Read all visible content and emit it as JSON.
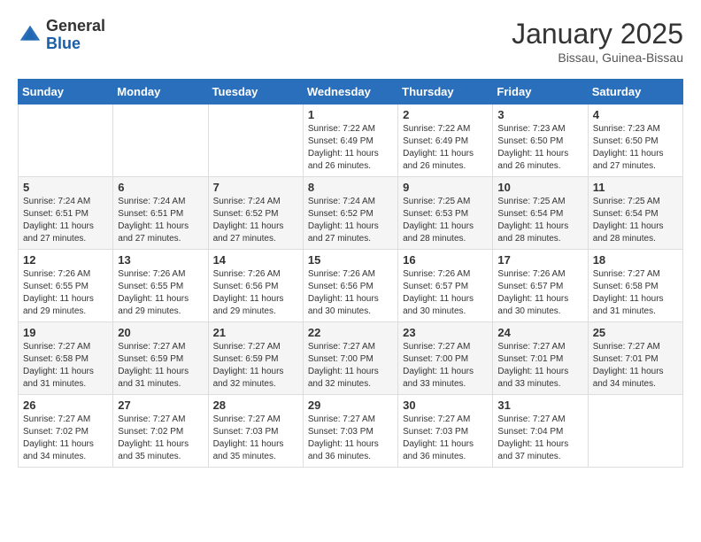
{
  "header": {
    "logo_general": "General",
    "logo_blue": "Blue",
    "title": "January 2025",
    "location": "Bissau, Guinea-Bissau"
  },
  "days_of_week": [
    "Sunday",
    "Monday",
    "Tuesday",
    "Wednesday",
    "Thursday",
    "Friday",
    "Saturday"
  ],
  "weeks": [
    [
      {
        "day": "",
        "info": ""
      },
      {
        "day": "",
        "info": ""
      },
      {
        "day": "",
        "info": ""
      },
      {
        "day": "1",
        "info": "Sunrise: 7:22 AM\nSunset: 6:49 PM\nDaylight: 11 hours and 26 minutes."
      },
      {
        "day": "2",
        "info": "Sunrise: 7:22 AM\nSunset: 6:49 PM\nDaylight: 11 hours and 26 minutes."
      },
      {
        "day": "3",
        "info": "Sunrise: 7:23 AM\nSunset: 6:50 PM\nDaylight: 11 hours and 26 minutes."
      },
      {
        "day": "4",
        "info": "Sunrise: 7:23 AM\nSunset: 6:50 PM\nDaylight: 11 hours and 27 minutes."
      }
    ],
    [
      {
        "day": "5",
        "info": "Sunrise: 7:24 AM\nSunset: 6:51 PM\nDaylight: 11 hours and 27 minutes."
      },
      {
        "day": "6",
        "info": "Sunrise: 7:24 AM\nSunset: 6:51 PM\nDaylight: 11 hours and 27 minutes."
      },
      {
        "day": "7",
        "info": "Sunrise: 7:24 AM\nSunset: 6:52 PM\nDaylight: 11 hours and 27 minutes."
      },
      {
        "day": "8",
        "info": "Sunrise: 7:24 AM\nSunset: 6:52 PM\nDaylight: 11 hours and 27 minutes."
      },
      {
        "day": "9",
        "info": "Sunrise: 7:25 AM\nSunset: 6:53 PM\nDaylight: 11 hours and 28 minutes."
      },
      {
        "day": "10",
        "info": "Sunrise: 7:25 AM\nSunset: 6:54 PM\nDaylight: 11 hours and 28 minutes."
      },
      {
        "day": "11",
        "info": "Sunrise: 7:25 AM\nSunset: 6:54 PM\nDaylight: 11 hours and 28 minutes."
      }
    ],
    [
      {
        "day": "12",
        "info": "Sunrise: 7:26 AM\nSunset: 6:55 PM\nDaylight: 11 hours and 29 minutes."
      },
      {
        "day": "13",
        "info": "Sunrise: 7:26 AM\nSunset: 6:55 PM\nDaylight: 11 hours and 29 minutes."
      },
      {
        "day": "14",
        "info": "Sunrise: 7:26 AM\nSunset: 6:56 PM\nDaylight: 11 hours and 29 minutes."
      },
      {
        "day": "15",
        "info": "Sunrise: 7:26 AM\nSunset: 6:56 PM\nDaylight: 11 hours and 30 minutes."
      },
      {
        "day": "16",
        "info": "Sunrise: 7:26 AM\nSunset: 6:57 PM\nDaylight: 11 hours and 30 minutes."
      },
      {
        "day": "17",
        "info": "Sunrise: 7:26 AM\nSunset: 6:57 PM\nDaylight: 11 hours and 30 minutes."
      },
      {
        "day": "18",
        "info": "Sunrise: 7:27 AM\nSunset: 6:58 PM\nDaylight: 11 hours and 31 minutes."
      }
    ],
    [
      {
        "day": "19",
        "info": "Sunrise: 7:27 AM\nSunset: 6:58 PM\nDaylight: 11 hours and 31 minutes."
      },
      {
        "day": "20",
        "info": "Sunrise: 7:27 AM\nSunset: 6:59 PM\nDaylight: 11 hours and 31 minutes."
      },
      {
        "day": "21",
        "info": "Sunrise: 7:27 AM\nSunset: 6:59 PM\nDaylight: 11 hours and 32 minutes."
      },
      {
        "day": "22",
        "info": "Sunrise: 7:27 AM\nSunset: 7:00 PM\nDaylight: 11 hours and 32 minutes."
      },
      {
        "day": "23",
        "info": "Sunrise: 7:27 AM\nSunset: 7:00 PM\nDaylight: 11 hours and 33 minutes."
      },
      {
        "day": "24",
        "info": "Sunrise: 7:27 AM\nSunset: 7:01 PM\nDaylight: 11 hours and 33 minutes."
      },
      {
        "day": "25",
        "info": "Sunrise: 7:27 AM\nSunset: 7:01 PM\nDaylight: 11 hours and 34 minutes."
      }
    ],
    [
      {
        "day": "26",
        "info": "Sunrise: 7:27 AM\nSunset: 7:02 PM\nDaylight: 11 hours and 34 minutes."
      },
      {
        "day": "27",
        "info": "Sunrise: 7:27 AM\nSunset: 7:02 PM\nDaylight: 11 hours and 35 minutes."
      },
      {
        "day": "28",
        "info": "Sunrise: 7:27 AM\nSunset: 7:03 PM\nDaylight: 11 hours and 35 minutes."
      },
      {
        "day": "29",
        "info": "Sunrise: 7:27 AM\nSunset: 7:03 PM\nDaylight: 11 hours and 36 minutes."
      },
      {
        "day": "30",
        "info": "Sunrise: 7:27 AM\nSunset: 7:03 PM\nDaylight: 11 hours and 36 minutes."
      },
      {
        "day": "31",
        "info": "Sunrise: 7:27 AM\nSunset: 7:04 PM\nDaylight: 11 hours and 37 minutes."
      },
      {
        "day": "",
        "info": ""
      }
    ]
  ]
}
